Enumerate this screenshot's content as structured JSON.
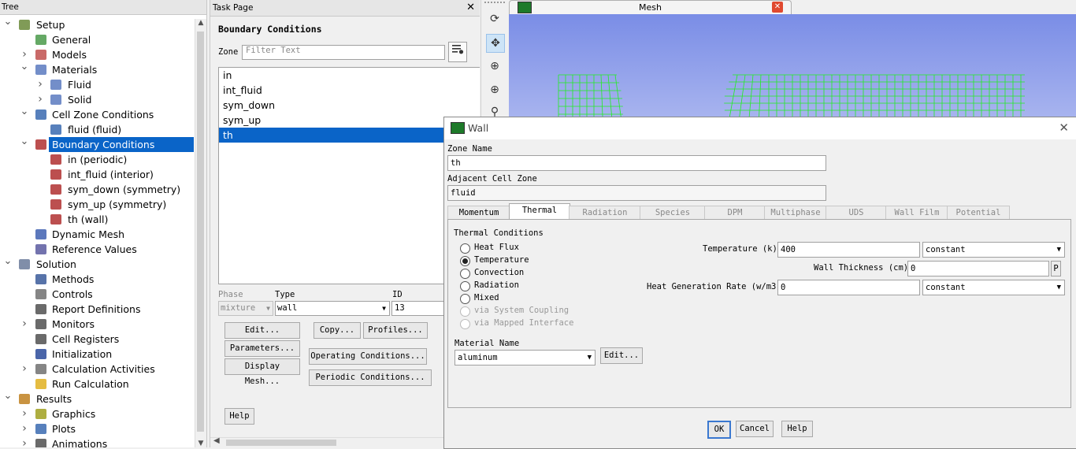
{
  "tree": {
    "header": "Tree",
    "items": [
      {
        "label": "Setup"
      },
      {
        "label": "General"
      },
      {
        "label": "Models"
      },
      {
        "label": "Materials"
      },
      {
        "label": "Fluid"
      },
      {
        "label": "Solid"
      },
      {
        "label": "Cell Zone Conditions"
      },
      {
        "label": "fluid (fluid)"
      },
      {
        "label": "Boundary Conditions"
      },
      {
        "label": "in (periodic)"
      },
      {
        "label": "int_fluid (interior)"
      },
      {
        "label": "sym_down (symmetry)"
      },
      {
        "label": "sym_up (symmetry)"
      },
      {
        "label": "th (wall)"
      },
      {
        "label": "Dynamic Mesh"
      },
      {
        "label": "Reference Values"
      },
      {
        "label": "Solution"
      },
      {
        "label": "Methods"
      },
      {
        "label": "Controls"
      },
      {
        "label": "Report Definitions"
      },
      {
        "label": "Monitors"
      },
      {
        "label": "Cell Registers"
      },
      {
        "label": "Initialization"
      },
      {
        "label": "Calculation Activities"
      },
      {
        "label": "Run Calculation"
      },
      {
        "label": "Results"
      },
      {
        "label": "Graphics"
      },
      {
        "label": "Plots"
      },
      {
        "label": "Animations"
      }
    ]
  },
  "task": {
    "header": "Task Page",
    "close": "✕",
    "title": "Boundary Conditions",
    "zone_label": "Zone",
    "filter_placeholder": "Filter Text",
    "zones": [
      "in",
      "int_fluid",
      "sym_down",
      "sym_up",
      "th"
    ],
    "selected_zone": "th",
    "phase_label": "Phase",
    "phase_value": "mixture",
    "type_label": "Type",
    "type_value": "wall",
    "id_label": "ID",
    "id_value": "13",
    "buttons": {
      "edit": "Edit...",
      "copy": "Copy...",
      "profiles": "Profiles...",
      "parameters": "Parameters...",
      "operating": "Operating Conditions...",
      "display_mesh": "Display Mesh...",
      "periodic": "Periodic Conditions...",
      "help": "Help"
    }
  },
  "graphics": {
    "tab_title": "Mesh",
    "mesh_color": "#22ee22",
    "background_top": "#7a8de6"
  },
  "wall": {
    "title": "Wall",
    "zone_name_label": "Zone Name",
    "zone_name": "th",
    "adjacent_label": "Adjacent Cell Zone",
    "adjacent": "fluid",
    "tabs": [
      "Momentum",
      "Thermal",
      "Radiation",
      "Species",
      "DPM",
      "Multiphase",
      "UDS",
      "Wall Film",
      "Potential"
    ],
    "active_tab": "Thermal",
    "thermal_conditions_label": "Thermal Conditions",
    "options": [
      {
        "label": "Heat Flux",
        "checked": false,
        "enabled": true
      },
      {
        "label": "Temperature",
        "checked": true,
        "enabled": true
      },
      {
        "label": "Convection",
        "checked": false,
        "enabled": true
      },
      {
        "label": "Radiation",
        "checked": false,
        "enabled": true
      },
      {
        "label": "Mixed",
        "checked": false,
        "enabled": true
      },
      {
        "label": "via System Coupling",
        "checked": false,
        "enabled": false
      },
      {
        "label": "via Mapped Interface",
        "checked": false,
        "enabled": false
      }
    ],
    "temperature_label": "Temperature (k)",
    "temperature": "400",
    "temperature_method": "constant",
    "thickness_label": "Wall Thickness (cm)",
    "thickness": "0",
    "thickness_p": "P",
    "heat_gen_label": "Heat Generation Rate (w/m3)",
    "heat_gen": "0",
    "heat_gen_method": "constant",
    "material_label": "Material Name",
    "material": "aluminum",
    "material_edit": "Edit...",
    "ok": "OK",
    "cancel": "Cancel",
    "help": "Help"
  }
}
